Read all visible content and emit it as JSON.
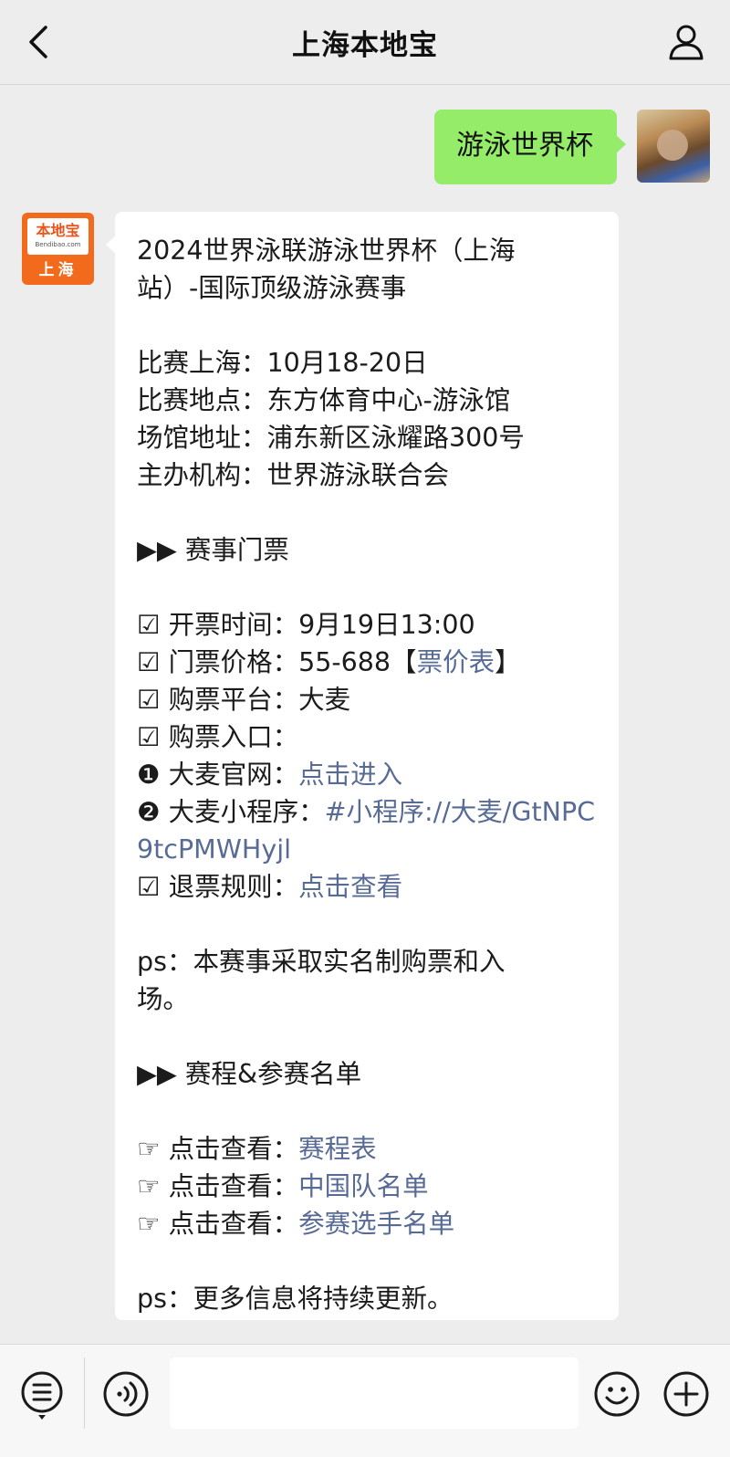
{
  "header": {
    "title": "上海本地宝",
    "back_icon": "chevron-left-icon",
    "profile_icon": "person-icon"
  },
  "user_message": {
    "text": "游泳世界杯"
  },
  "bot": {
    "avatar_top": "本地宝",
    "avatar_domain": "Bendibao.com",
    "avatar_city": "上海"
  },
  "bot_message": {
    "title_line1": "2024世界泳联游泳世界杯（上海",
    "title_line2": "站）-国际顶级游泳赛事",
    "info": [
      "比赛上海：10月18-20日",
      "比赛地点：东方体育中心-游泳馆",
      "场馆地址：浦东新区泳耀路300号",
      "主办机构：世界游泳联合会"
    ],
    "section1_heading": "▶▶ 赛事门票",
    "ticket_time": "☑ 开票时间：9月19日13:00",
    "ticket_price_prefix": "☑ 门票价格：55-688【",
    "ticket_price_link": "票价表",
    "ticket_price_suffix": "】",
    "platform": "☑ 购票平台：大麦",
    "entry": "☑ 购票入口：",
    "damai_site_prefix": "❶ 大麦官网：",
    "damai_site_link": "点击进入",
    "damai_mini_prefix": "❷ 大麦小程序：",
    "damai_mini_link": "#小程序://大麦/GtNPC9tcPMWHyjl",
    "refund_prefix": "☑ 退票规则：",
    "refund_link": "点击查看",
    "ps1_line1": "ps：本赛事采取实名制购票和入",
    "ps1_line2": "场。",
    "section2_heading": "▶▶ 赛程&参赛名单",
    "schedule_items": [
      {
        "prefix": "☞ 点击查看：",
        "link": "赛程表"
      },
      {
        "prefix": "☞ 点击查看：",
        "link": "中国队名单"
      },
      {
        "prefix": "☞ 点击查看：",
        "link": "参赛选手名单"
      }
    ],
    "ps2": "ps：更多信息将持续更新。"
  },
  "inputbar": {
    "menu_icon": "menu-list-icon",
    "voice_icon": "voice-icon",
    "emoji_icon": "emoji-icon",
    "plus_icon": "plus-icon",
    "input_value": ""
  },
  "colors": {
    "background": "#ededed",
    "user_bubble": "#95ec69",
    "link": "#576b95",
    "brand_orange": "#f26a1b"
  }
}
